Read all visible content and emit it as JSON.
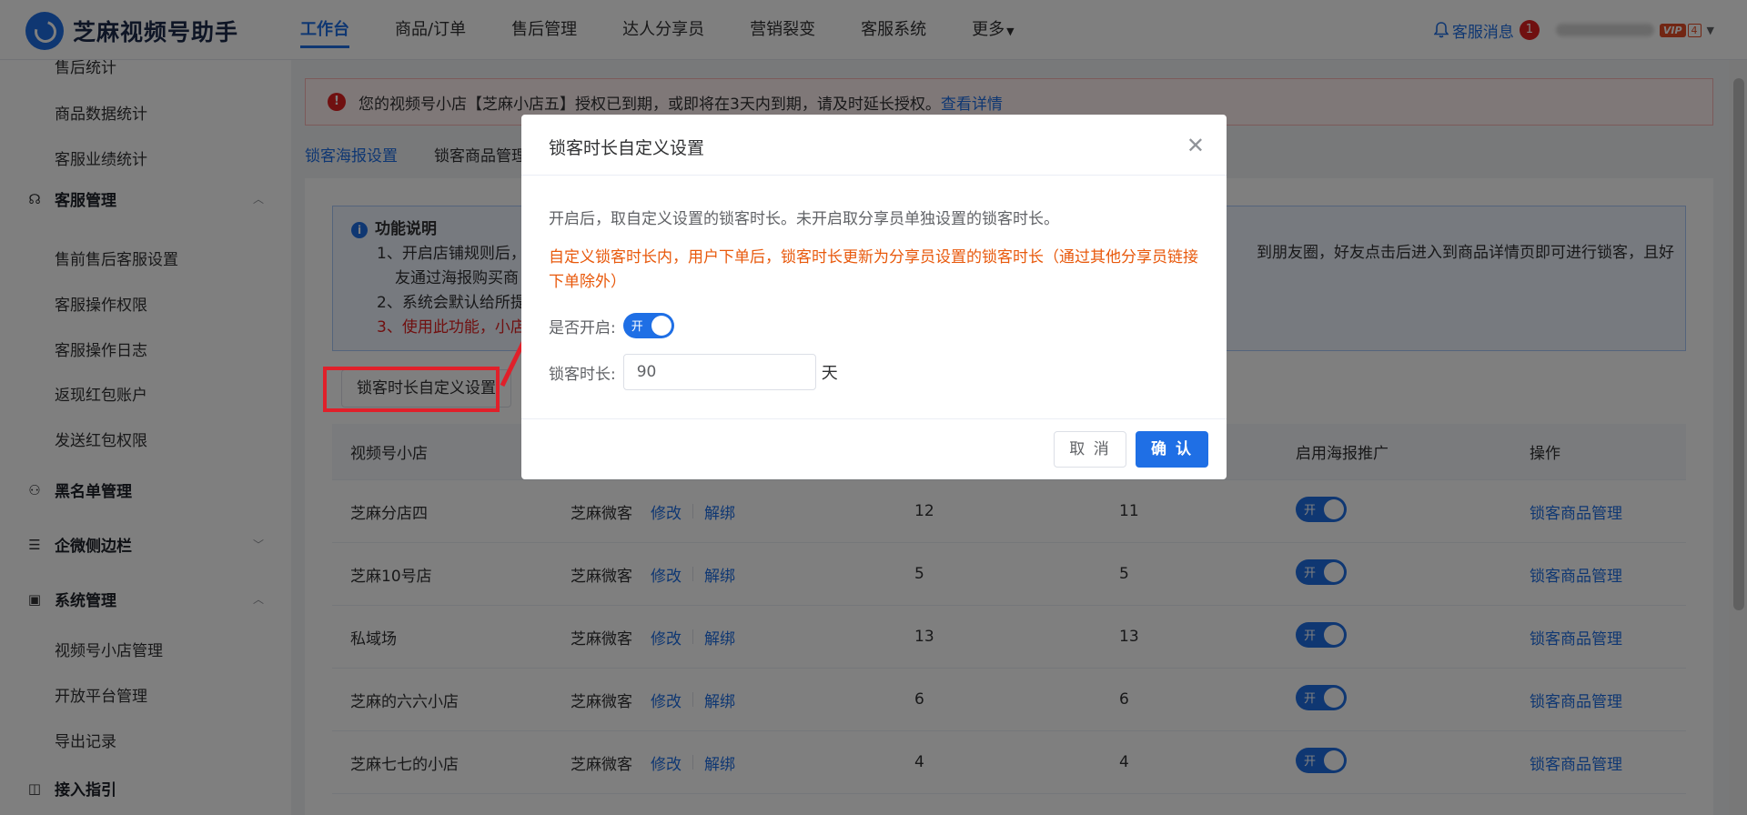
{
  "header": {
    "app_name": "芝麻视频号助手",
    "nav": [
      {
        "label": "工作台",
        "active": true
      },
      {
        "label": "商品/订单"
      },
      {
        "label": "售后管理"
      },
      {
        "label": "达人分享员"
      },
      {
        "label": "营销裂变"
      },
      {
        "label": "客服系统"
      },
      {
        "label": "更多"
      }
    ],
    "message_label": "客服消息",
    "message_count": "1",
    "vip_label": "VIP",
    "vip_level": "4"
  },
  "sidebar": {
    "items": [
      {
        "label": "售后统计"
      },
      {
        "label": "商品数据统计"
      },
      {
        "label": "客服业绩统计"
      },
      {
        "label": "客服管理"
      },
      {
        "label": "售前售后客服设置"
      },
      {
        "label": "客服操作权限"
      },
      {
        "label": "客服操作日志"
      },
      {
        "label": "返现红包账户"
      },
      {
        "label": "发送红包权限"
      },
      {
        "label": "黑名单管理"
      },
      {
        "label": "企微侧边栏"
      },
      {
        "label": "系统管理"
      },
      {
        "label": "视频号小店管理"
      },
      {
        "label": "开放平台管理"
      },
      {
        "label": "导出记录"
      },
      {
        "label": "接入指引"
      }
    ]
  },
  "alert": {
    "text": "您的视频号小店【芝麻小店五】授权已到期，或即将在3天内到期，请及时延长授权。",
    "link": "查看详情"
  },
  "tabs": [
    {
      "label": "锁客海报设置",
      "active": true
    },
    {
      "label": "锁客商品管理"
    }
  ],
  "info": {
    "title": "功能说明",
    "line1": "1、开启店铺规则后，",
    "line1b": "友通过海报购买商",
    "line1_right": "到朋友圈，好友点击后进入到商品详情页即可进行锁客，且好",
    "line2": "2、系统会默认给所提",
    "line3": "3、使用此功能，小店"
  },
  "lock_button": "锁客时长自定义设置",
  "table": {
    "headers": {
      "shop": "视频号小店",
      "switch": "启用海报推广",
      "op": "操作"
    },
    "rows": [
      {
        "shop": "芝麻分店四",
        "acct": "芝麻微客",
        "edit": "修改",
        "unbind": "解绑",
        "a": "12",
        "b": "11",
        "sw": "开",
        "op": "锁客商品管理"
      },
      {
        "shop": "芝麻10号店",
        "acct": "芝麻微客",
        "edit": "修改",
        "unbind": "解绑",
        "a": "5",
        "b": "5",
        "sw": "开",
        "op": "锁客商品管理"
      },
      {
        "shop": "私域场",
        "acct": "芝麻微客",
        "edit": "修改",
        "unbind": "解绑",
        "a": "13",
        "b": "13",
        "sw": "开",
        "op": "锁客商品管理"
      },
      {
        "shop": "芝麻的六六小店",
        "acct": "芝麻微客",
        "edit": "修改",
        "unbind": "解绑",
        "a": "6",
        "b": "6",
        "sw": "开",
        "op": "锁客商品管理"
      },
      {
        "shop": "芝麻七七的小店",
        "acct": "芝麻微客",
        "edit": "修改",
        "unbind": "解绑",
        "a": "4",
        "b": "4",
        "sw": "开",
        "op": "锁客商品管理"
      }
    ]
  },
  "dialog": {
    "title": "锁客时长自定义设置",
    "tip": "开启后，取自定义设置的锁客时长。未开启取分享员单独设置的锁客时长。",
    "warning": "自定义锁客时长内，用户下单后，锁客时长更新为分享员设置的锁客时长（通过其他分享员链接下单除外）",
    "enable_label": "是否开启:",
    "enable_switch": "开",
    "duration_label": "锁客时长:",
    "duration_value": "90",
    "duration_unit": "天",
    "cancel": "取 消",
    "confirm": "确 认"
  },
  "colors": {
    "primary": "#1f6fe5",
    "danger": "#e02020",
    "warning_text": "#e8590c"
  }
}
